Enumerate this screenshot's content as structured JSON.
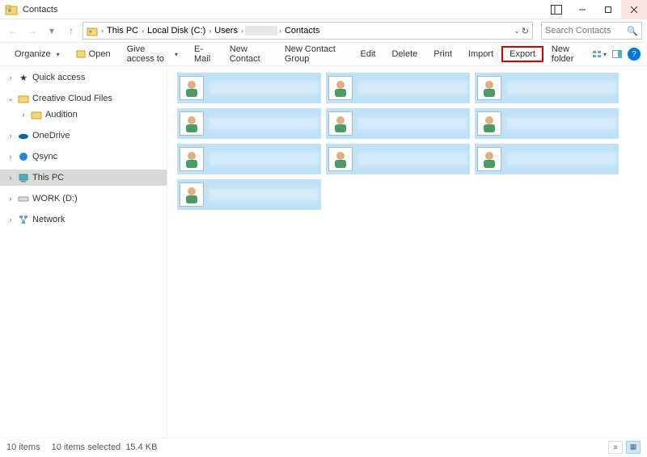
{
  "window": {
    "title": "Contacts"
  },
  "breadcrumbs": {
    "segments": [
      "This PC",
      "Local Disk (C:)",
      "Users"
    ],
    "blurred_segment": "",
    "current": "Contacts"
  },
  "search": {
    "placeholder": "Search Contacts"
  },
  "toolbar": {
    "organize": "Organize",
    "open": "Open",
    "give_access": "Give access to",
    "email": "E-Mail",
    "new_contact": "New Contact",
    "new_group": "New Contact Group",
    "edit": "Edit",
    "delete": "Delete",
    "print": "Print",
    "import": "Import",
    "export": "Export",
    "new_folder": "New folder"
  },
  "nav": {
    "quick_access": "Quick access",
    "creative_cloud": "Creative Cloud Files",
    "audition": "Audition",
    "onedrive": "OneDrive",
    "qsync": "Qsync",
    "this_pc": "This PC",
    "work_d": "WORK (D:)",
    "network": "Network"
  },
  "contacts": {
    "rows": [
      [
        "",
        "",
        ""
      ],
      [
        "",
        "",
        ""
      ],
      [
        "",
        "",
        ""
      ],
      [
        ""
      ]
    ]
  },
  "status": {
    "items": "10 items",
    "selected": "10 items selected",
    "size": "15.4 KB"
  }
}
